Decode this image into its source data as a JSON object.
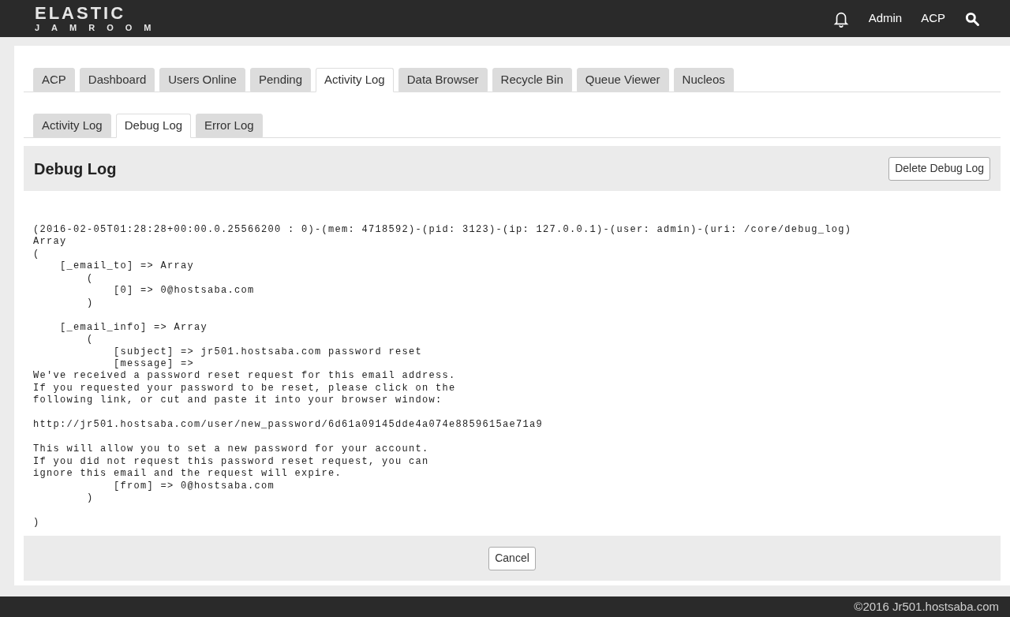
{
  "header": {
    "logo_top": "ELASTIC",
    "logo_bottom": "JAMROOM",
    "nav": [
      "Admin",
      "ACP"
    ]
  },
  "tabs": [
    {
      "label": "ACP",
      "selected": false
    },
    {
      "label": "Dashboard",
      "selected": false
    },
    {
      "label": "Users Online",
      "selected": false
    },
    {
      "label": "Pending",
      "selected": false
    },
    {
      "label": "Activity Log",
      "selected": true
    },
    {
      "label": "Data Browser",
      "selected": false
    },
    {
      "label": "Recycle Bin",
      "selected": false
    },
    {
      "label": "Queue Viewer",
      "selected": false
    },
    {
      "label": "Nucleos",
      "selected": false
    }
  ],
  "subtabs": [
    {
      "label": "Activity Log",
      "selected": false
    },
    {
      "label": "Debug Log",
      "selected": true
    },
    {
      "label": "Error Log",
      "selected": false
    }
  ],
  "panel": {
    "title": "Debug Log",
    "action": "Delete Debug Log"
  },
  "log": "(2016-02-05T01:28:28+00:00.0.25566200 : 0)-(mem: 4718592)-(pid: 3123)-(ip: 127.0.0.1)-(user: admin)-(uri: /core/debug_log)\nArray\n(\n    [_email_to] => Array\n        (\n            [0] => 0@hostsaba.com\n        )\n\n    [_email_info] => Array\n        (\n            [subject] => jr501.hostsaba.com password reset\n            [message] => \nWe've received a password reset request for this email address.\nIf you requested your password to be reset, please click on the\nfollowing link, or cut and paste it into your browser window:\n\nhttp://jr501.hostsaba.com/user/new_password/6d61a09145dde4a074e8859615ae71a9\n\nThis will allow you to set a new password for your account.\nIf you did not request this password reset request, you can\nignore this email and the request will expire.\n            [from] => 0@hostsaba.com\n        )\n\n)",
  "cancel": "Cancel",
  "footer": "©2016 Jr501.hostsaba.com"
}
